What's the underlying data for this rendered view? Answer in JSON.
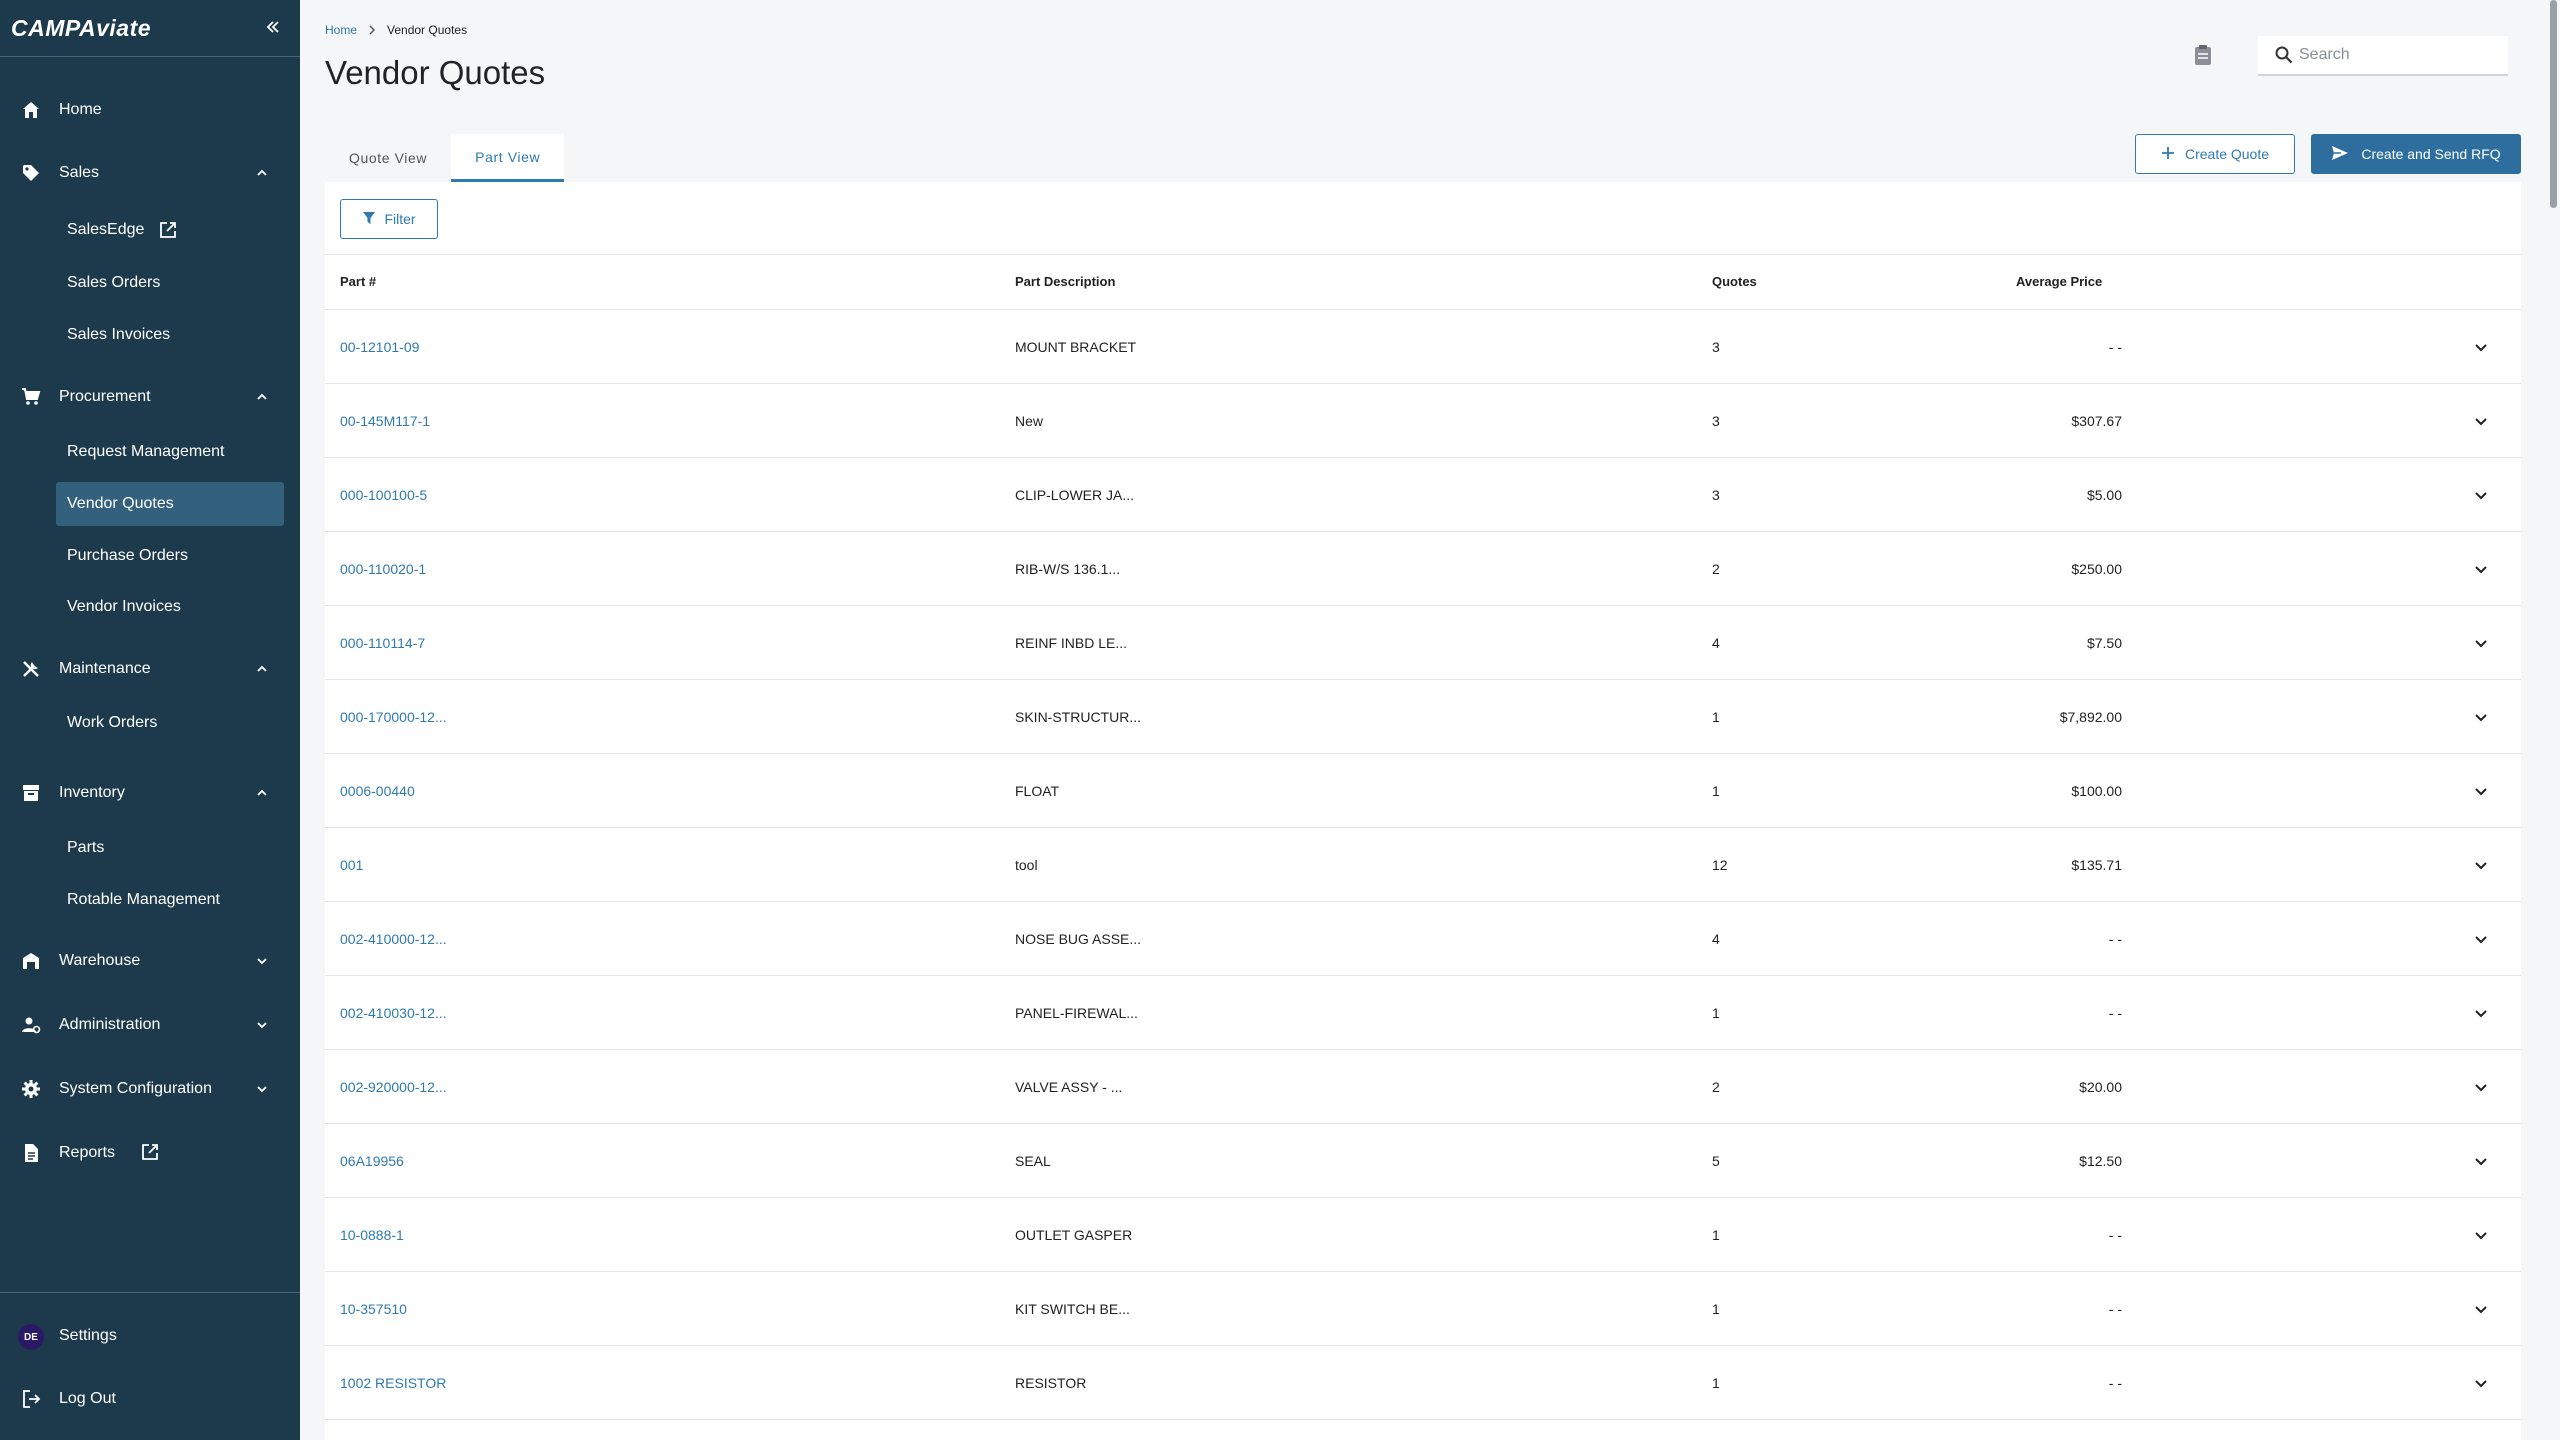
{
  "app": {
    "logo_text": "CAMPAviate",
    "collapse_icon": "double-chevron-left-icon"
  },
  "sidebar": {
    "items": [
      {
        "label": "Home",
        "icon": "home-icon"
      },
      {
        "label": "Sales",
        "icon": "tag-icon",
        "expanded": true,
        "children": [
          {
            "label": "SalesEdge",
            "external": true
          },
          {
            "label": "Sales Orders"
          },
          {
            "label": "Sales Invoices"
          }
        ]
      },
      {
        "label": "Procurement",
        "icon": "cart-icon",
        "expanded": true,
        "children": [
          {
            "label": "Request Management"
          },
          {
            "label": "Vendor Quotes",
            "active": true
          },
          {
            "label": "Purchase Orders"
          },
          {
            "label": "Vendor Invoices"
          }
        ]
      },
      {
        "label": "Maintenance",
        "icon": "tools-icon",
        "expanded": true,
        "children": [
          {
            "label": "Work Orders"
          }
        ]
      },
      {
        "label": "Inventory",
        "icon": "archive-icon",
        "expanded": true,
        "children": [
          {
            "label": "Parts"
          },
          {
            "label": "Rotable Management"
          }
        ]
      },
      {
        "label": "Warehouse",
        "icon": "warehouse-icon",
        "expanded": false
      },
      {
        "label": "Administration",
        "icon": "user-gear-icon",
        "expanded": false
      },
      {
        "label": "System Configuration",
        "icon": "gear-icon",
        "expanded": false
      },
      {
        "label": "Reports",
        "icon": "document-icon",
        "external": true
      }
    ],
    "footer": {
      "settings_label": "Settings",
      "avatar_initials": "DE",
      "logout_label": "Log Out"
    }
  },
  "header": {
    "breadcrumb": {
      "home": "Home",
      "current": "Vendor Quotes"
    },
    "title": "Vendor Quotes",
    "search_placeholder": "Search"
  },
  "tabs": [
    {
      "label": "Quote View",
      "active": false
    },
    {
      "label": "Part View",
      "active": true
    }
  ],
  "actions": {
    "create_quote": "Create Quote",
    "create_rfq": "Create and Send RFQ",
    "filter": "Filter"
  },
  "table": {
    "columns": [
      "Part #",
      "Part Description",
      "Quotes",
      "Average Price"
    ],
    "rows": [
      {
        "part": "00-12101-09",
        "desc": "MOUNT BRACKET",
        "quotes": "3",
        "price": "- -"
      },
      {
        "part": "00-145M117-1",
        "desc": "New",
        "quotes": "3",
        "price": "$307.67"
      },
      {
        "part": "000-100100-5",
        "desc": "CLIP-LOWER JA...",
        "quotes": "3",
        "price": "$5.00"
      },
      {
        "part": "000-110020-1",
        "desc": "RIB-W/S 136.1...",
        "quotes": "2",
        "price": "$250.00"
      },
      {
        "part": "000-110114-7",
        "desc": "REINF INBD LE...",
        "quotes": "4",
        "price": "$7.50"
      },
      {
        "part": "000-170000-12...",
        "desc": "SKIN-STRUCTUR...",
        "quotes": "1",
        "price": "$7,892.00"
      },
      {
        "part": "0006-00440",
        "desc": "FLOAT",
        "quotes": "1",
        "price": "$100.00"
      },
      {
        "part": "001",
        "desc": "tool",
        "quotes": "12",
        "price": "$135.71"
      },
      {
        "part": "002-410000-12...",
        "desc": "NOSE BUG ASSE...",
        "quotes": "4",
        "price": "- -"
      },
      {
        "part": "002-410030-12...",
        "desc": "PANEL-FIREWAL...",
        "quotes": "1",
        "price": "- -"
      },
      {
        "part": "002-920000-12...",
        "desc": "VALVE ASSY - ...",
        "quotes": "2",
        "price": "$20.00"
      },
      {
        "part": "06A19956",
        "desc": "SEAL",
        "quotes": "5",
        "price": "$12.50"
      },
      {
        "part": "10-0888-1",
        "desc": "OUTLET GASPER",
        "quotes": "1",
        "price": "- -"
      },
      {
        "part": "10-357510",
        "desc": "KIT SWITCH BE...",
        "quotes": "1",
        "price": "- -"
      },
      {
        "part": "1002 RESISTOR",
        "desc": "RESISTOR",
        "quotes": "1",
        "price": "- -"
      }
    ]
  },
  "colors": {
    "sidebar_bg": "#1d3a4c",
    "sidebar_active": "#33617d",
    "accent": "#2f7ab0",
    "primary_button": "#2d6e9e"
  }
}
